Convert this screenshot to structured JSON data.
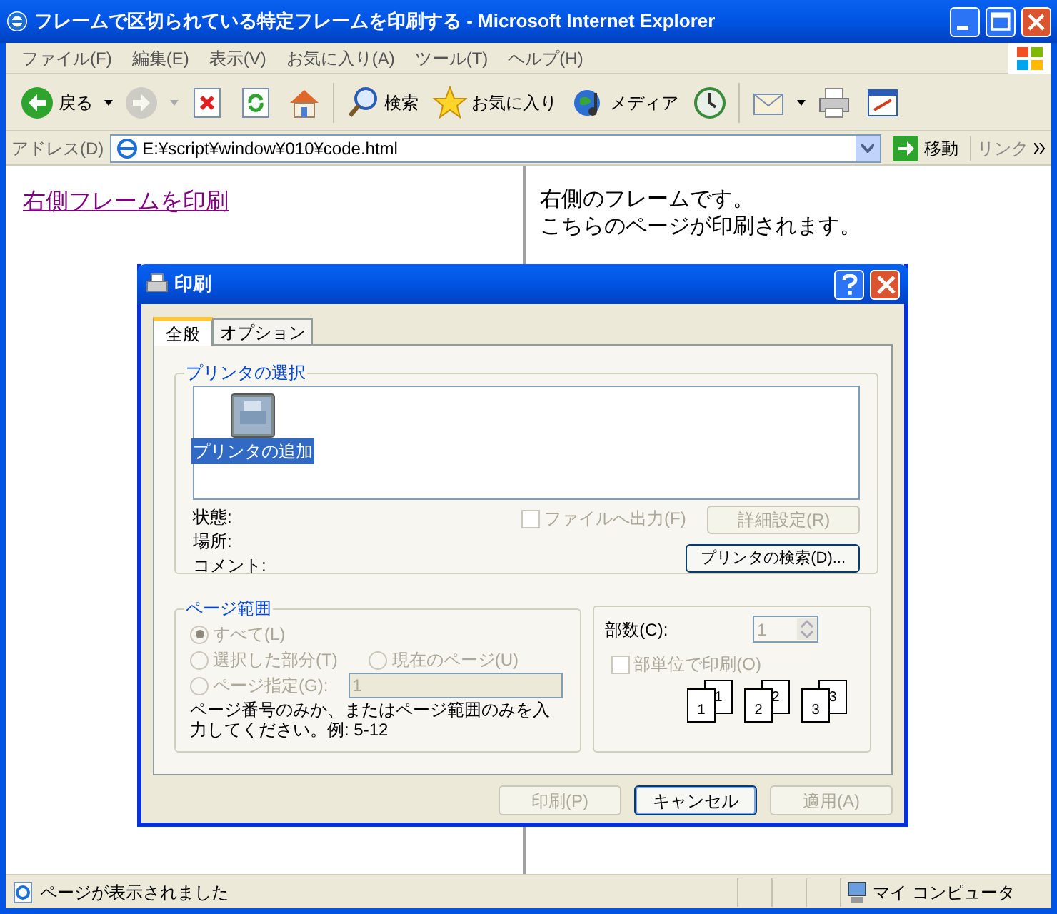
{
  "window": {
    "title": "フレームで区切られている特定フレームを印刷する - Microsoft Internet Explorer"
  },
  "menu": [
    "ファイル(F)",
    "編集(E)",
    "表示(V)",
    "お気に入り(A)",
    "ツール(T)",
    "ヘルプ(H)"
  ],
  "toolbar": [
    {
      "kind": "back",
      "label": "戻る",
      "disabled": false
    },
    {
      "kind": "forward",
      "disabled": true
    },
    {
      "kind": "stop"
    },
    {
      "kind": "refresh"
    },
    {
      "kind": "home"
    },
    {
      "kind": "search",
      "label": "検索"
    },
    {
      "kind": "favorites",
      "label": "お気に入り"
    },
    {
      "kind": "media",
      "label": "メディア"
    },
    {
      "kind": "history"
    },
    {
      "kind": "mail"
    },
    {
      "kind": "print"
    },
    {
      "kind": "edit"
    }
  ],
  "address": {
    "label": "アドレス(D)",
    "value": "E:¥script¥window¥010¥code.html",
    "go": "移動",
    "links": "リンク"
  },
  "left_frame": {
    "link": "右側フレームを印刷"
  },
  "right_frame": {
    "lines": [
      "右側のフレームです。",
      "こちらのページが印刷されます。"
    ]
  },
  "dialog": {
    "title": "印刷",
    "tabs": [
      {
        "label": "全般",
        "selected": true
      },
      {
        "label": "オプション",
        "selected": false
      }
    ],
    "printer_group": "プリンタの選択",
    "printers": [
      {
        "label": "プリンタの追加",
        "selected": true
      }
    ],
    "info_labels": [
      "状態:",
      "場所:",
      "コメント:"
    ],
    "print_to_file": {
      "label": "ファイルへ出力(F)",
      "checked": false,
      "disabled": true
    },
    "preferences": {
      "label": "詳細設定(R)",
      "disabled": true
    },
    "find_printer": {
      "label": "プリンタの検索(D)...",
      "disabled": false
    },
    "page_range": {
      "legend": "ページ範囲",
      "options": [
        {
          "label": "すべて(L)",
          "selected": true,
          "disabled": true
        },
        {
          "label": "選択した部分(T)",
          "selected": false,
          "disabled": true
        },
        {
          "label": "現在のページ(U)",
          "selected": false,
          "disabled": true
        },
        {
          "label": "ページ指定(G):",
          "selected": false,
          "disabled": true
        }
      ],
      "pages_value": "1",
      "hint": "ページ番号のみか、またはページ範囲のみを入力してください。例: 5-12"
    },
    "copies": {
      "label": "部数(C):",
      "value": "1",
      "collate": {
        "label": "部単位で印刷(O)",
        "checked": false,
        "disabled": true
      },
      "pages": [
        "1",
        "1",
        "2",
        "2",
        "3",
        "3"
      ]
    },
    "buttons": [
      {
        "label": "印刷(P)",
        "disabled": true,
        "default": false
      },
      {
        "label": "キャンセル",
        "disabled": false,
        "default": true
      },
      {
        "label": "適用(A)",
        "disabled": true,
        "default": false
      }
    ]
  },
  "status_bar": {
    "text": "ページが表示されました",
    "zone": "マイ コンピュータ"
  }
}
